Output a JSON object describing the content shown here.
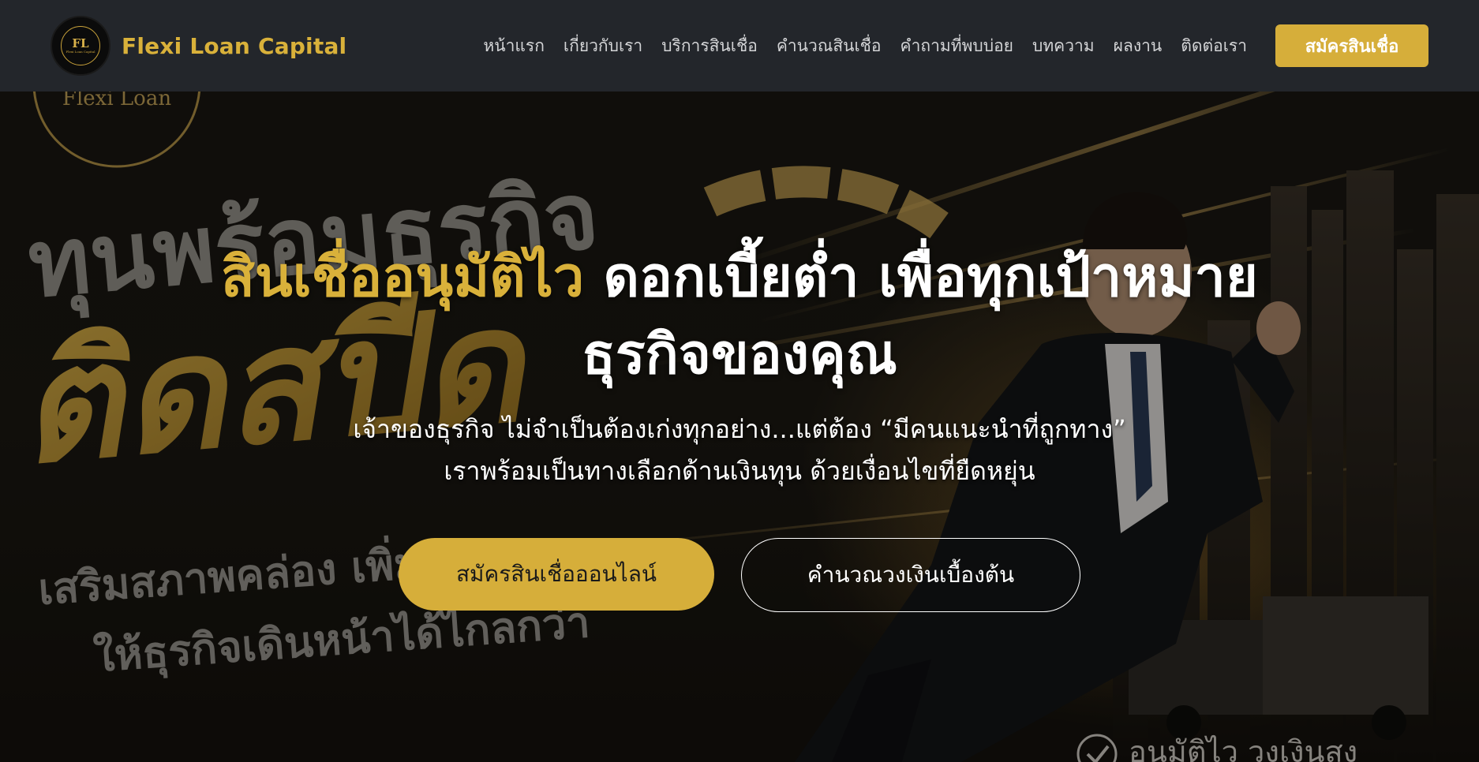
{
  "header": {
    "brand_name": "Flexi Loan Capital",
    "logo_monogram": "FL",
    "logo_caption": "Flexi Loan Capital",
    "nav_items": [
      {
        "label": "หน้าแรก"
      },
      {
        "label": "เกี่ยวกับเรา"
      },
      {
        "label": "บริการสินเชื่อ"
      },
      {
        "label": "คำนวณสินเชื่อ"
      },
      {
        "label": "คำถามที่พบบ่อย"
      },
      {
        "label": "บทความ"
      },
      {
        "label": "ผลงาน"
      },
      {
        "label": "ติดต่อเรา"
      }
    ],
    "cta_label": "สมัครสินเชื่อ"
  },
  "hero": {
    "title_accent": "สินเชื่ออนุมัติไว",
    "title_rest": " ดอกเบี้ยต่ำ เพื่อทุกเป้าหมาย",
    "title_line2": "ธุรกิจของคุณ",
    "subtitle_line1": "เจ้าของธุรกิจ ไม่จำเป็นต้องเก่งทุกอย่าง...แต่ต้อง “มีคนแนะนำที่ถูกทาง”",
    "subtitle_line2": "เราพร้อมเป็นทางเลือกด้านเงินทุน ด้วยเงื่อนไขที่ยืดหยุ่น",
    "primary_button": "สมัครสินเชื่อออนไลน์",
    "secondary_button": "คำนวณวงเงินเบื้องต้น"
  },
  "background": {
    "logo_text": "Flexi Loan",
    "big_text_1": "ทุนพร้อมธุรกิจ",
    "big_text_2": "ติดสปีด",
    "tagline_1": "เสริมสภาพคล่อง เพิ่ม",
    "tagline_2": "ให้ธุรกิจเดินหน้าได้ไกลกว่า",
    "badge_text": "อนุมัติไว วงเงินสูง"
  },
  "colors": {
    "accent": "#d6ae3a",
    "header_bg": "#23262b",
    "text": "#ffffff"
  }
}
